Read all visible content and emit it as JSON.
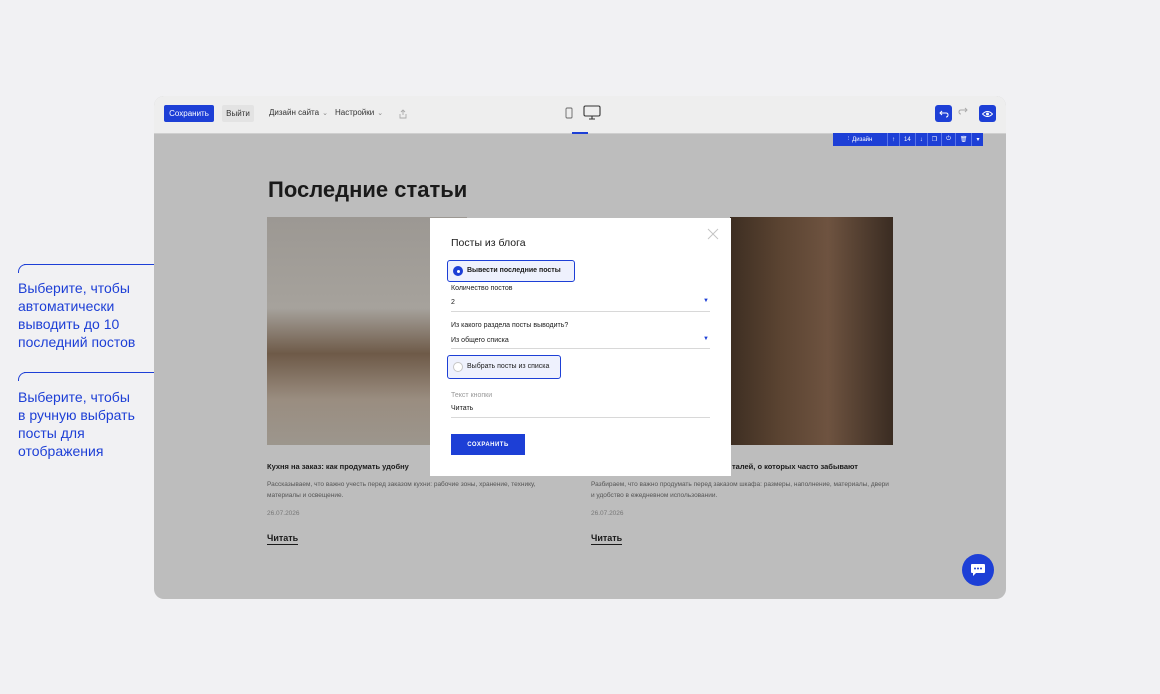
{
  "topbar": {
    "save": "Сохранить",
    "exit": "Выйти",
    "menu_design": "Дизайн сайта",
    "menu_settings": "Настройки"
  },
  "block_toolbar": {
    "design_label": "Дизайн",
    "count": "14"
  },
  "page": {
    "heading": "Последние статьи",
    "cards": [
      {
        "title": "Кухня на заказ: как продумать удобну",
        "desc": "Рассказываем, что важно учесть перед заказом кухни: рабочие зоны, хранение, технику, материалы и освещение.",
        "date": "26.07.2026",
        "link": "Читать"
      },
      {
        "title": "талей, о которых часто забывают",
        "desc": "Разбираем, что важно продумать перед заказом шкафа: размеры, наполнение, материалы, двери и удобство в ежедневном использовании.",
        "date": "26.07.2026",
        "link": "Читать"
      }
    ]
  },
  "modal": {
    "title": "Посты из блога",
    "option_latest": "Вывести последние посты",
    "option_latest_selected": true,
    "count_label": "Количество постов",
    "count_value": "2",
    "section_label": "Из какого раздела посты выводить?",
    "section_value": "Из общего списка",
    "option_choose": "Выбрать посты из списка",
    "option_choose_selected": false,
    "button_text_label": "Текст кнопки",
    "button_text_value": "Читать",
    "save": "СОХРАНИТЬ"
  },
  "annotations": {
    "first": [
      "Выберите, чтобы",
      "автоматически",
      "выводить до 10",
      "последний постов"
    ],
    "second": [
      "Выберите, чтобы",
      "в ручную выбрать",
      "посты для",
      "отображения"
    ]
  },
  "colors": {
    "accent": "#1d3fd6",
    "page_bg": "#f1f1f3",
    "editor_overlay": "#bdbdbd"
  }
}
